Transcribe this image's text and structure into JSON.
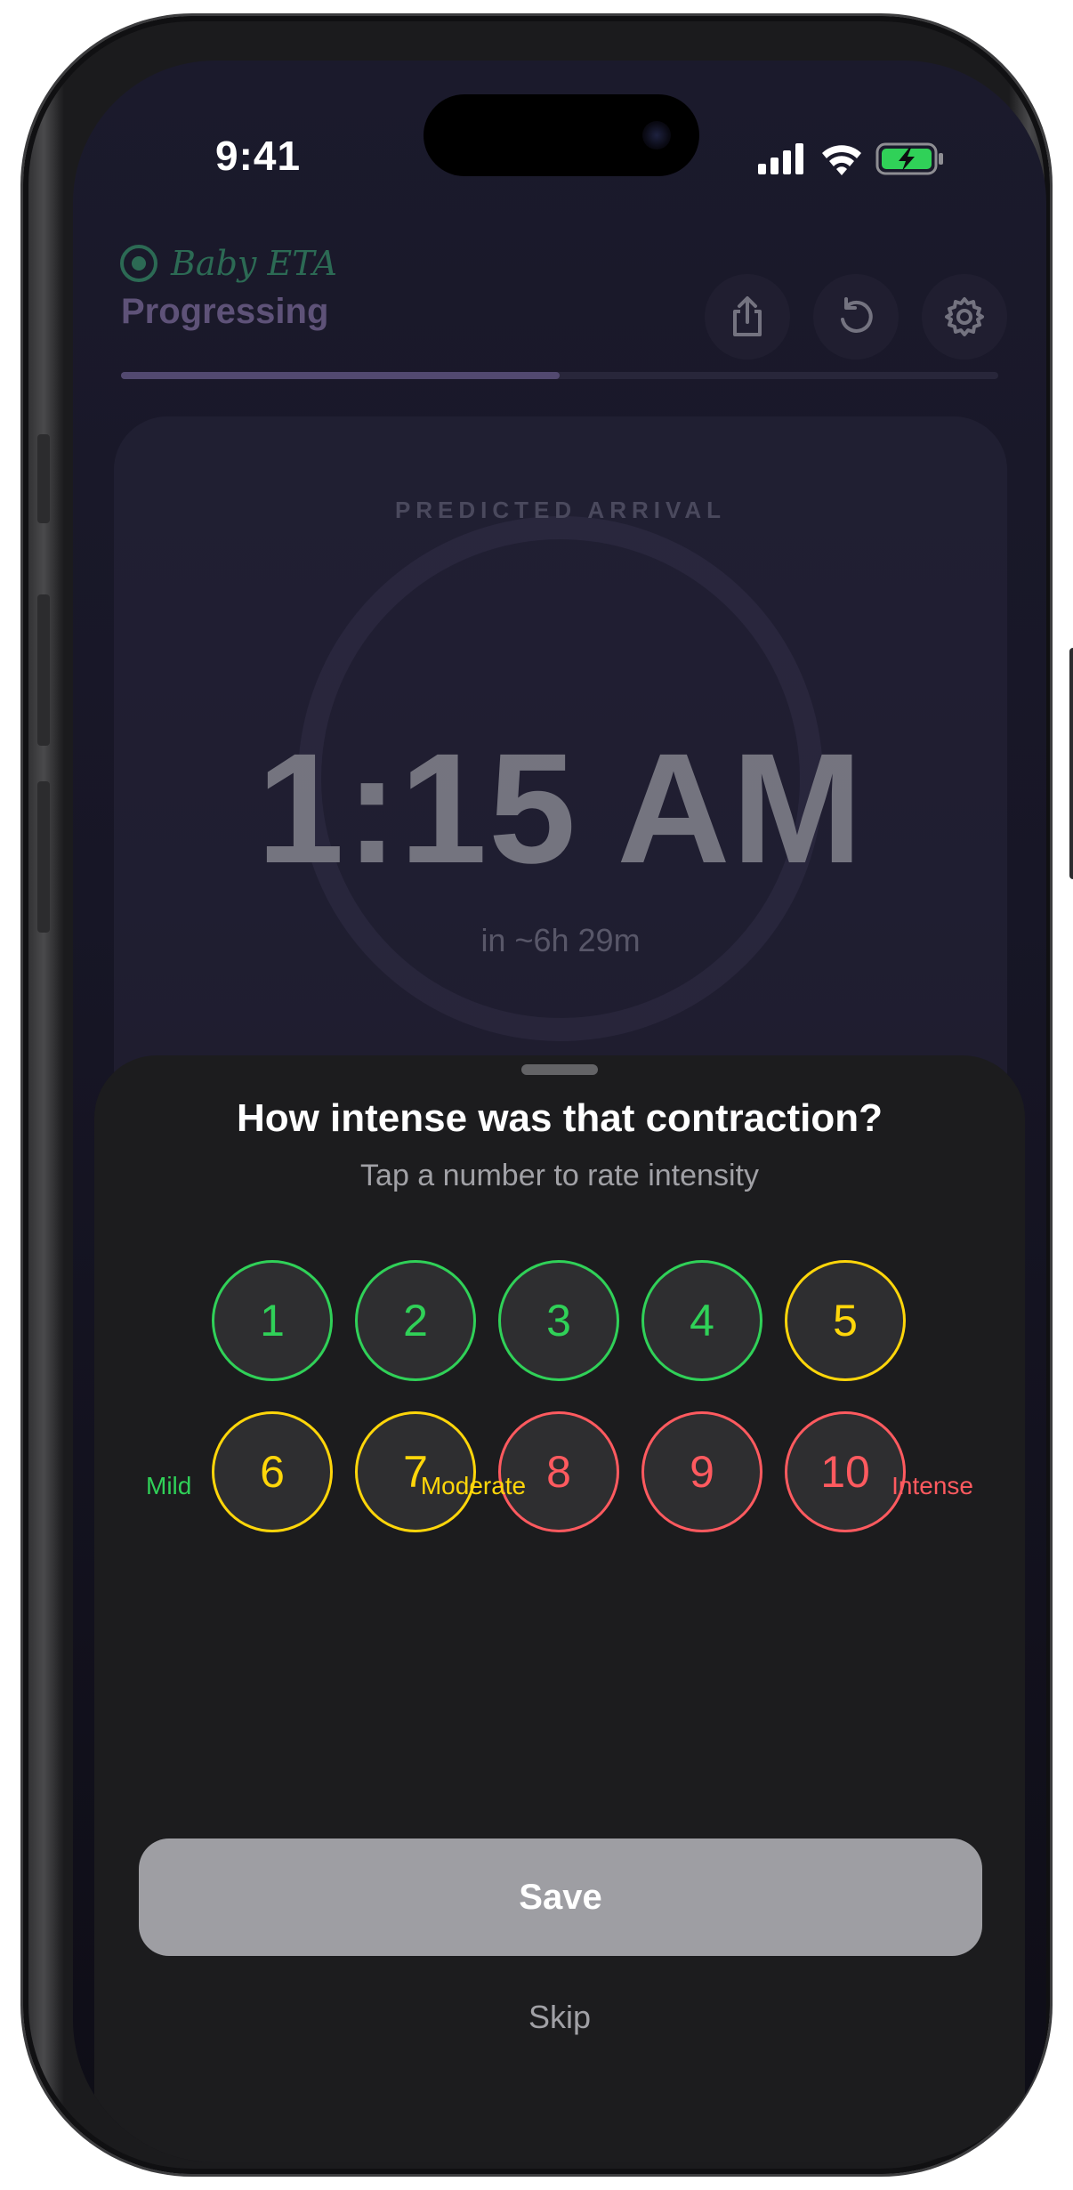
{
  "status_bar": {
    "time": "9:41",
    "icons": [
      "cellular-signal-icon",
      "wifi-icon",
      "battery-charging-icon"
    ]
  },
  "header": {
    "brand_icon": "target-icon",
    "brand_name": "Baby ETA",
    "stage": "Progressing",
    "progress_fraction": 0.5,
    "actions": [
      "share-icon",
      "reset-icon",
      "settings-icon"
    ]
  },
  "prediction": {
    "label": "PREDICTED ARRIVAL",
    "time": "1:15 AM",
    "countdown": "in ~6h 29m"
  },
  "sheet": {
    "title": "How intense was that contraction?",
    "subtitle": "Tap a number to rate intensity",
    "options": [
      {
        "label": "1",
        "level": "mild"
      },
      {
        "label": "2",
        "level": "mild"
      },
      {
        "label": "3",
        "level": "mild"
      },
      {
        "label": "4",
        "level": "mild"
      },
      {
        "label": "5",
        "level": "moderate"
      },
      {
        "label": "6",
        "level": "moderate"
      },
      {
        "label": "7",
        "level": "moderate"
      },
      {
        "label": "8",
        "level": "intense"
      },
      {
        "label": "9",
        "level": "intense"
      },
      {
        "label": "10",
        "level": "intense"
      }
    ],
    "scale": {
      "mild": "Mild",
      "moderate": "Moderate",
      "intense": "Intense"
    },
    "save_label": "Save",
    "skip_label": "Skip"
  },
  "colors": {
    "mild": "#30d158",
    "moderate": "#ffd60a",
    "intense": "#ff5a5f",
    "brand": "#43d18a",
    "stage": "#b49ad8"
  }
}
